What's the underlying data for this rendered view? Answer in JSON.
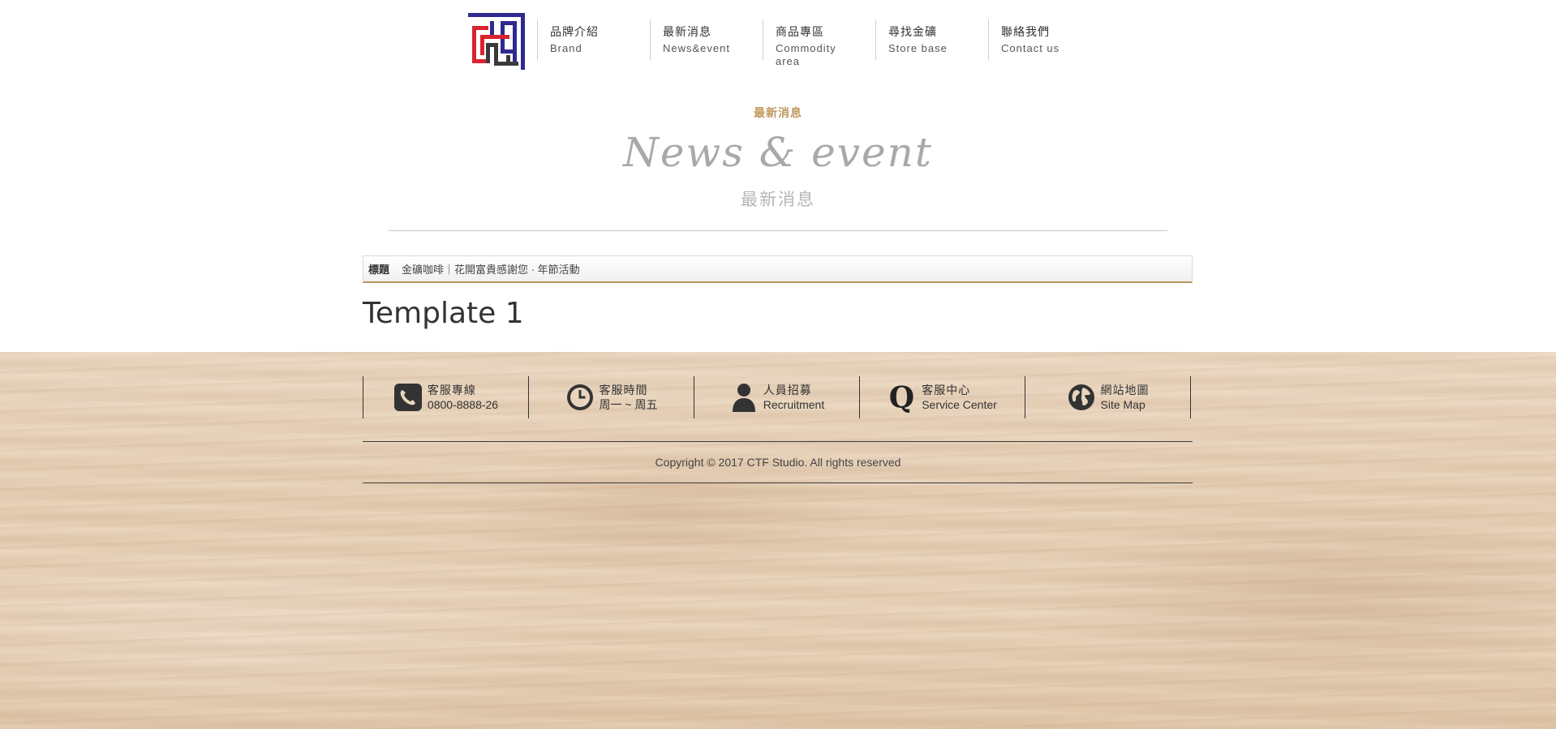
{
  "header": {
    "nav": [
      {
        "zh": "品牌介紹",
        "en": "Brand"
      },
      {
        "zh": "最新消息",
        "en": "News&event"
      },
      {
        "zh": "商品專區",
        "en": "Commodity area"
      },
      {
        "zh": "尋找金礦",
        "en": "Store base"
      },
      {
        "zh": "聯絡我們",
        "en": "Contact us"
      }
    ]
  },
  "main": {
    "kicker": "最新消息",
    "display_title": "News & event",
    "subtitle": "最新消息",
    "title_label": "標題",
    "title_value": "金礦咖啡｜花開富貴感謝您 · 年節活動",
    "template_heading": "Template 1"
  },
  "footer": {
    "info": [
      {
        "icon": "phone-icon",
        "zh": "客服專線",
        "sub": "0800-8888-26"
      },
      {
        "icon": "clock-icon",
        "zh": "客服時間",
        "sub": "周一 ~ 周五"
      },
      {
        "icon": "person-icon",
        "zh": "人員招募",
        "sub": "Recruitment"
      },
      {
        "icon": "q-icon",
        "zh": "客服中心",
        "sub": "Service Center"
      },
      {
        "icon": "globe-icon",
        "zh": "網站地圖",
        "sub": "Site Map"
      }
    ],
    "copyright": "Copyright © 2017 CTF Studio. All rights reserved"
  },
  "colors": {
    "accent_gold": "#c0975c",
    "logo_red": "#d9232e",
    "logo_blue": "#2e2a8f",
    "text_dark": "#333333"
  }
}
